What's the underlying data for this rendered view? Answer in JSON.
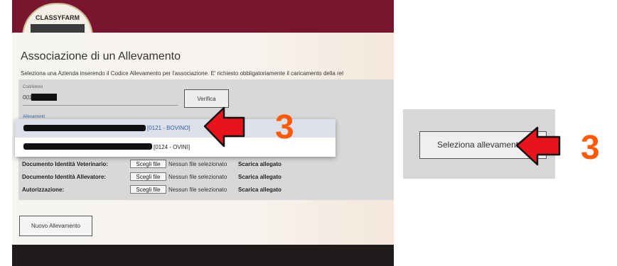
{
  "app": {
    "logo_text": "CLASSYFARM"
  },
  "page": {
    "title": "Associazione di un Allevamento",
    "subtitle": "Seleziona una Azienda inserendo il Codice Allevamento per l'associazione. E' richiesto obbligatoriamente il caricamento della rel"
  },
  "form": {
    "cod_label": "CodAllevix",
    "cod_value": "001",
    "verifica_label": "Verifica",
    "allevamenti_label": "Allevamenti",
    "options": [
      {
        "text": "[0121 - BOVINO]",
        "selected": true
      },
      {
        "text": "[0124 - OVINI]",
        "selected": false
      }
    ],
    "documents": [
      {
        "label": "Documento Identità Veterinario:",
        "button": "Scegli file",
        "status": "Nessun file selezionato",
        "download": "Scarica allegato"
      },
      {
        "label": "Documento Identità Allevatore:",
        "button": "Scegli file",
        "status": "Nessun file selezionato",
        "download": "Scarica allegato"
      },
      {
        "label": "Autorizzazione:",
        "button": "Scegli file",
        "status": "Nessun file selezionato",
        "download": "Scarica allegato"
      }
    ],
    "nuovo_label": "Nuovo Allevamento"
  },
  "right": {
    "seleziona_label": "Seleziona allevamento"
  },
  "annotations": {
    "step_left": "3",
    "step_right": "3",
    "arrow_color": "#e8131b",
    "number_color": "#ff5a0a"
  },
  "colors": {
    "topbar": "#7a1530",
    "footer": "#1f1b1b",
    "form_bg": "#d8d8d8",
    "link_blue": "#2f5bb0"
  }
}
